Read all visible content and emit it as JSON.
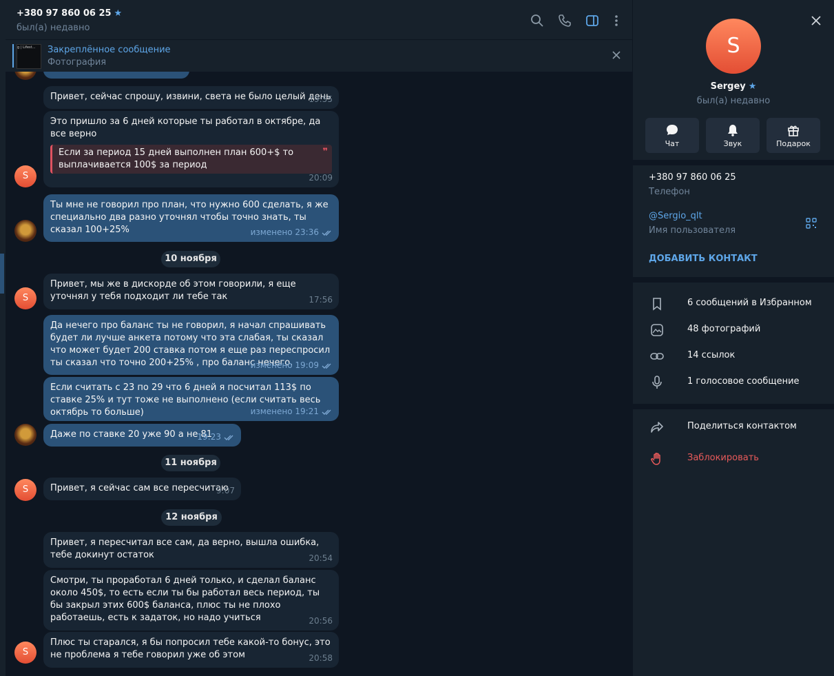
{
  "header": {
    "title": "+380 97 860 06 25",
    "status": "был(а) недавно"
  },
  "pinned": {
    "thumb_text": "g | Lifest...",
    "title": "Закреплённое сообщение",
    "subtitle": "Фотография"
  },
  "messages": [
    {
      "text": "Привет, сейчас спрошу, извини, света не было целый день",
      "time": "19:55"
    },
    {
      "text": "Это пришло за 6 дней которые ты работал в октябре, да все верно",
      "quote": "Если за период 15 дней выполнен план 600+$ то выплачивается 100$ за период",
      "time": "20:09",
      "avatar": "S"
    },
    {
      "text": "Ты мне не говорил про план, что нужно 600 сделать, я же специально два разно уточнял чтобы точно знать, ты сказал 100+25%",
      "time": "изменено 23:36"
    },
    {
      "text": "Привет, мы же в дискорде об этом говорили, я еще уточнял у тебя подходит ли тебе так",
      "time": "17:56",
      "avatar": "S"
    },
    {
      "text": "Да нечего про баланс ты не говорил, я начал спрашивать будет ли лучше анкета потому что эта слабая, ты сказал что может будет 200 ставка потом я еще раз переспросил ты сказал что точно 200+25% , про баланс нечего.",
      "time": "изменено 19:09"
    },
    {
      "text": "Если считать с 23 по 29 что 6 дней я посчитал 113$ по ставке 25% и тут тоже не выполнено (если считать весь октябрь то больше)",
      "time": "изменено 19:21"
    },
    {
      "text": "Даже по ставке 20 уже 90 а не 81",
      "time": "19:23"
    },
    {
      "text": "Привет, я сейчас сам все пересчитаю",
      "time": "9:07",
      "avatar": "S"
    },
    {
      "text": "Привет, я пересчитал все сам, да верно, вышла ошибка, тебе докинут остаток",
      "time": "20:54"
    },
    {
      "text": "Смотри, ты проработал 6 дней только, и сделал баланс около 450$, то есть если ты бы работал весь период, ты бы закрыл этих 600$ баланса, плюс ты не плохо работаешь, есть к задаток, но надо учиться",
      "time": "20:56"
    },
    {
      "text": "Плюс ты старался, я бы попросил тебе какой-то бонус, это не проблема я тебе говорил уже об этом",
      "time": "20:58",
      "avatar": "S"
    }
  ],
  "dates": [
    "10 ноября",
    "11 ноября",
    "12 ноября"
  ],
  "profile": {
    "avatar_letter": "S",
    "name": "Sergey",
    "status": "был(а) недавно",
    "actions": [
      "Чат",
      "Звук",
      "Подарок"
    ],
    "phone": "+380 97 860 06 25",
    "phone_label": "Телефон",
    "username": "@Sergio_qlt",
    "username_label": "Имя пользователя",
    "add_contact": "ДОБАВИТЬ КОНТАКТ",
    "media": [
      "6 сообщений в Избранном",
      "48 фотографий",
      "14 ссылок",
      "1 голосовое сообщение"
    ],
    "share": "Поделиться контактом",
    "block": "Заблокировать"
  },
  "colors": {
    "background": "#0e1621",
    "panel": "#17212b",
    "incoming_bubble": "#182533",
    "outgoing_bubble": "#2b5278",
    "accent": "#5ea6e8",
    "danger": "#e85a5a"
  }
}
